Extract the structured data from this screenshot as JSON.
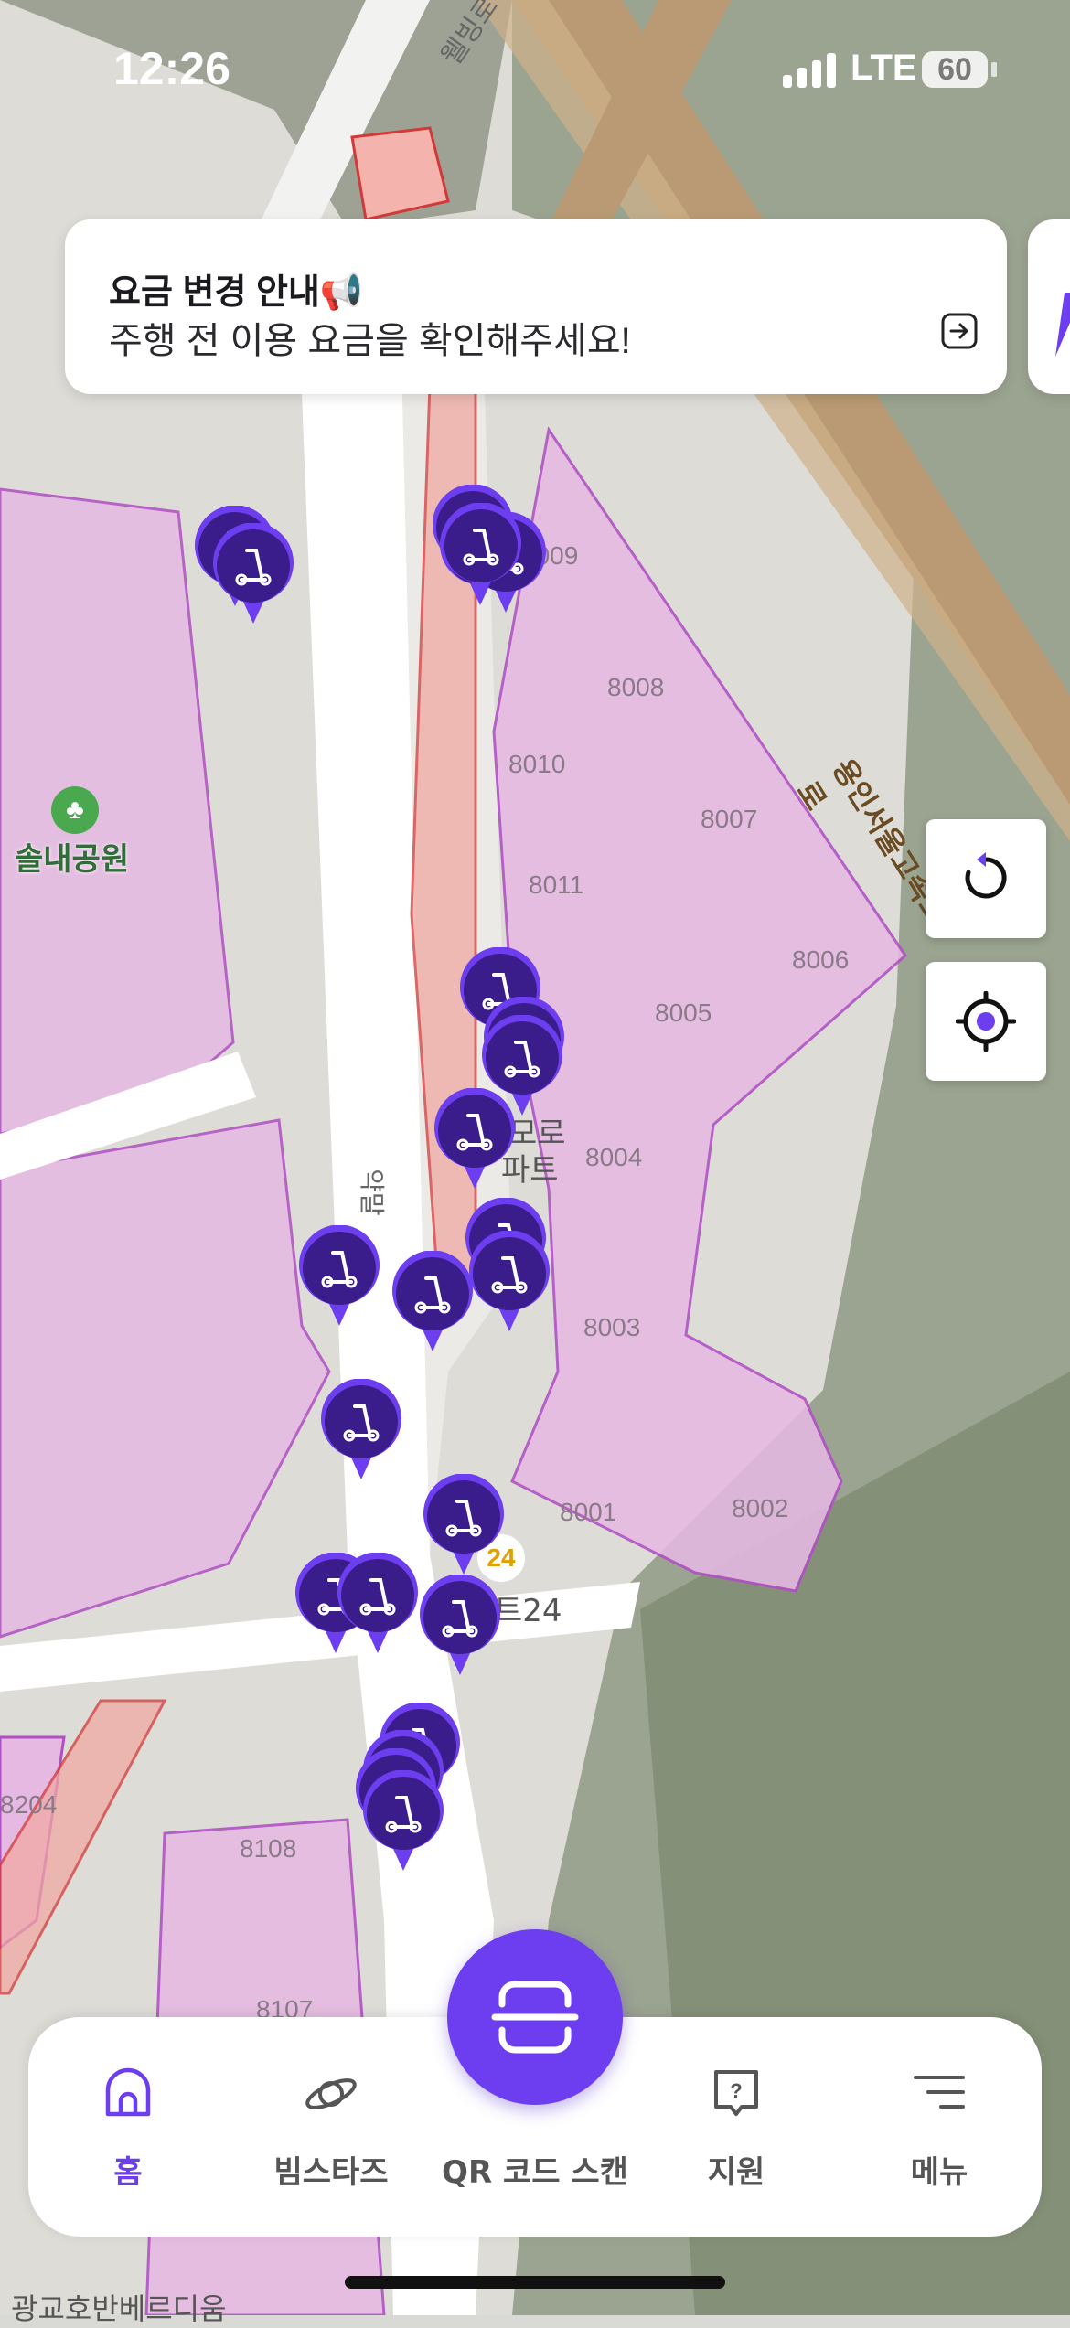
{
  "status_bar": {
    "time": "12:26",
    "network": "LTE",
    "battery": "60"
  },
  "notice": {
    "title": "요금 변경 안내📢",
    "text": "주행 전 이용 요금을 확인해주세요!"
  },
  "map": {
    "labels": {
      "road_top": "웰빙로",
      "highway": "용인서울고속도로",
      "park": "솔내공원",
      "apt_partial_1": "모로",
      "apt_partial_2": "파트",
      "road_side": "약말",
      "store": "트24",
      "store_badge": "24",
      "bottom_building": "광교호반베르디움"
    },
    "building_numbers": [
      "8009",
      "8008",
      "8010",
      "8007",
      "8011",
      "8006",
      "8005",
      "8004",
      "8003",
      "8001",
      "8002",
      "8204",
      "8108",
      "8107"
    ]
  },
  "map_buttons": {
    "refresh": "refresh-icon",
    "locate": "locate-icon"
  },
  "tabbar": {
    "tabs": [
      {
        "id": "home",
        "label": "홈",
        "active": true
      },
      {
        "id": "beamstars",
        "label": "빔스타즈",
        "active": false
      },
      {
        "id": "qr",
        "label": "QR 코드 스캔",
        "active": false
      },
      {
        "id": "support",
        "label": "지원",
        "active": false
      },
      {
        "id": "menu",
        "label": "메뉴",
        "active": false
      }
    ]
  },
  "colors": {
    "accent": "#6d3ef0",
    "pin": "#3a1d8a",
    "zone": "#e9b8e6",
    "zone_border": "#b04fc4"
  }
}
